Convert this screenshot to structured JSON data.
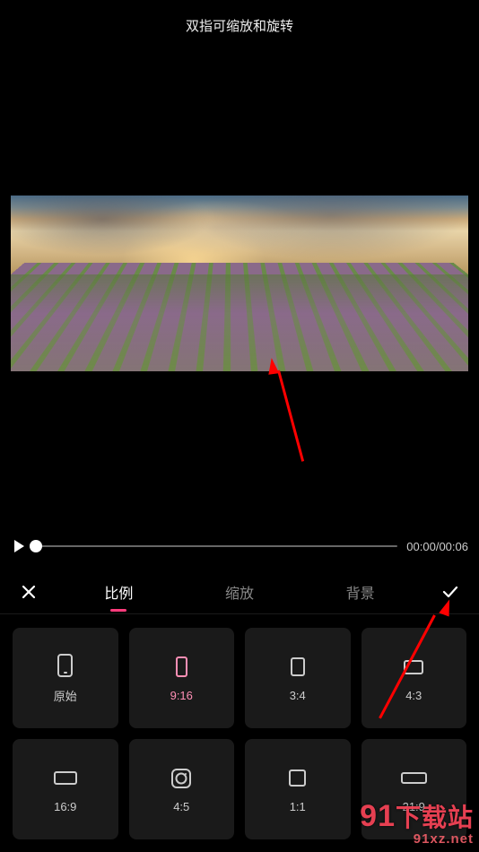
{
  "hint": "双指可缩放和旋转",
  "playback": {
    "current_time": "00:00",
    "total_time": "00:06"
  },
  "tabs": {
    "ratio": "比例",
    "zoom": "缩放",
    "background": "背景"
  },
  "ratios": {
    "original": "原始",
    "r9_16": "9:16",
    "r3_4": "3:4",
    "r4_3": "4:3",
    "r16_9": "16:9",
    "r4_5": "4:5",
    "r1_1": "1:1",
    "r21_9": "21:9"
  },
  "watermark": {
    "brand_prefix": "91",
    "brand_suffix": "下载站",
    "url": "91xz.net"
  }
}
